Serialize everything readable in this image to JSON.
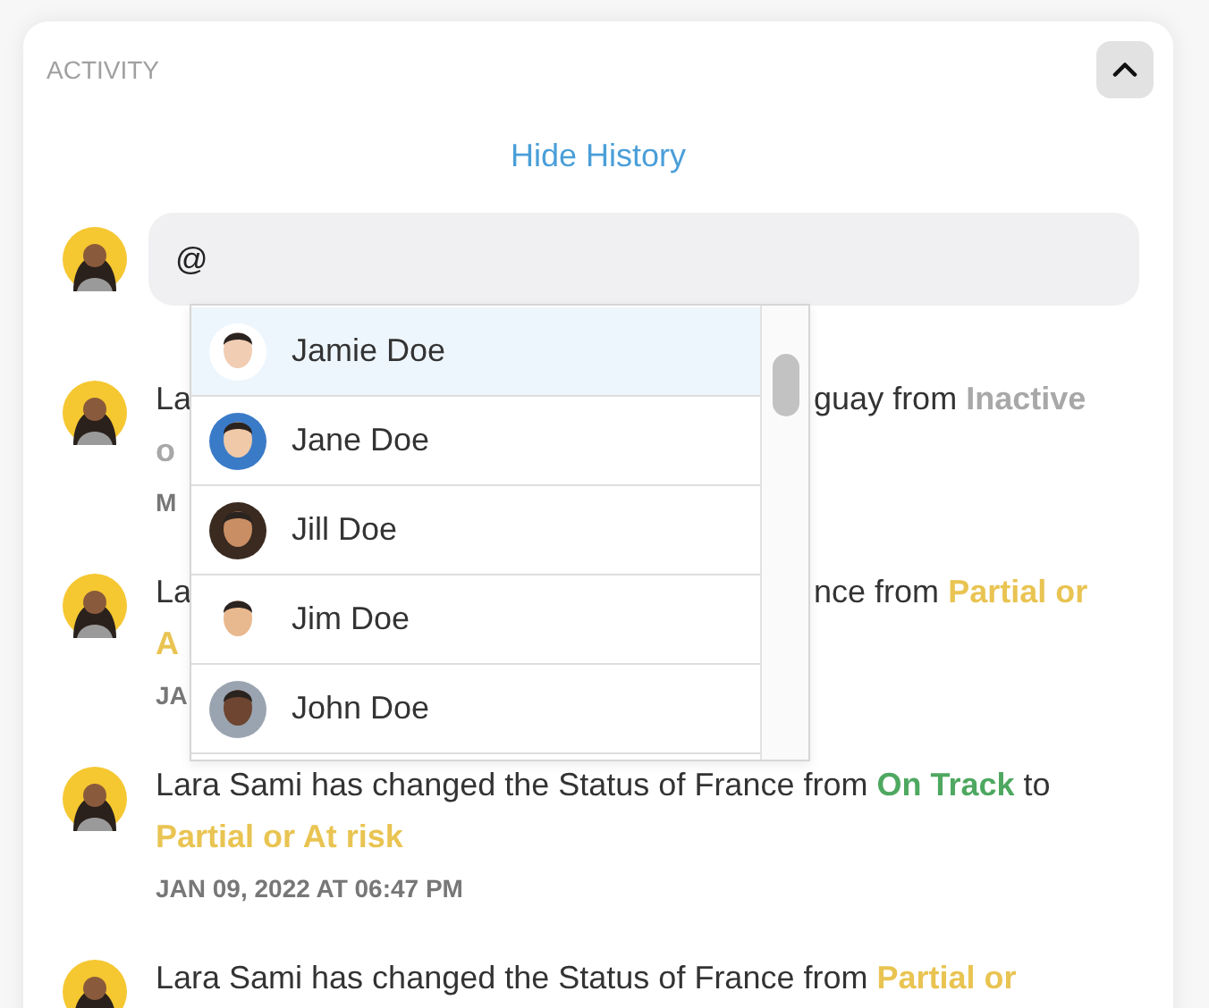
{
  "activity": {
    "title": "ACTIVITY",
    "collapse_button": {
      "expanded": true
    },
    "history_link": "Hide History",
    "composer": {
      "value": "@"
    },
    "mention_dropdown": {
      "items": [
        {
          "name": "Jamie Doe",
          "selected": true
        },
        {
          "name": "Jane Doe",
          "selected": false
        },
        {
          "name": "Jill Doe",
          "selected": false
        },
        {
          "name": "Jim Doe",
          "selected": false
        },
        {
          "name": "John Doe",
          "selected": false
        }
      ]
    },
    "entries": [
      {
        "kind": "covered",
        "text_left": "La",
        "text_right": "guay from",
        "status": {
          "text": "Inactive",
          "color": "#a8a8a8"
        },
        "line2": {
          "text": "o",
          "color": "#a8a8a8"
        },
        "time": "M"
      },
      {
        "kind": "covered",
        "text_left": "La",
        "text_right": "nce from",
        "status": {
          "text": "Partial or",
          "color": "#e9c452"
        },
        "line2": {
          "text": "A",
          "color": "#e9c452"
        },
        "time": "JA"
      },
      {
        "kind": "full",
        "segments": [
          {
            "text": "Lara Sami has changed the Status of France from "
          },
          {
            "text": "On Track",
            "color": "#4ea860"
          },
          {
            "text": " to "
          },
          {
            "text": "Partial or At risk",
            "color": "#e9c452"
          }
        ],
        "time": "JAN 09, 2022 AT 06:47 PM"
      },
      {
        "kind": "full",
        "segments": [
          {
            "text": "Lara Sami has changed the Status of France from "
          },
          {
            "text": "Partial or",
            "color": "#e9c452"
          }
        ]
      }
    ]
  }
}
